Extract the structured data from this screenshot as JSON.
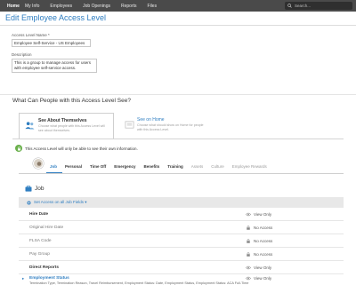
{
  "topnav": {
    "brand": "Home",
    "links": [
      "My Info",
      "Employees",
      "Job Openings",
      "Reports",
      "Files"
    ],
    "search_placeholder": "Search..."
  },
  "page": {
    "title": "Edit Employee Access Level"
  },
  "form": {
    "name_label": "Access Level Name *",
    "name_value": "Employee Self-Service - US Employees",
    "description_label": "Description",
    "description_value": "This is a group to manage access for users with employee self-service access."
  },
  "section": {
    "heading": "What Can People with this Access Level See?"
  },
  "options": [
    {
      "title": "See About Themselves",
      "description": "Choose what people with this Access Level will see about themselves.",
      "icon": "people-icon"
    },
    {
      "title": "See on Home",
      "description": "Choose what should show on Home for people with this Access Level.",
      "icon": "home-icon"
    }
  ],
  "notice": {
    "text": "This Access Level will only be able to see their own information."
  },
  "tabs": [
    "Job",
    "Personal",
    "Time Off",
    "Emergency",
    "Benefits",
    "Training",
    "Assets",
    "Culture",
    "Employee Rewards"
  ],
  "job": {
    "heading": "Job",
    "access_control": "Set Access on all Job Fields ▾",
    "rows": [
      {
        "name": "Hire Date",
        "permission": "View Only",
        "perm_icon": "eye-icon"
      },
      {
        "name": "Original Hire Date",
        "permission": "No Access",
        "perm_icon": "lock-icon"
      },
      {
        "name": "FLSA Code",
        "permission": "No Access",
        "perm_icon": "lock-icon"
      },
      {
        "name": "Pay Group",
        "permission": "No Access",
        "perm_icon": "lock-icon"
      },
      {
        "name": "Direct Reports",
        "permission": "View Only",
        "perm_icon": "eye-icon"
      }
    ],
    "employment_status": {
      "name": "Employment Status",
      "description": "Termination Type, Termination Reason, Travel Reimbursement, Employment Status: Date, Employment Status, Employment Status: ACA Full-Time",
      "permission": "View Only"
    }
  },
  "colors": {
    "accent": "#2f7ec1",
    "nav_bg": "#4a4a4a",
    "success": "#6ab04c"
  }
}
